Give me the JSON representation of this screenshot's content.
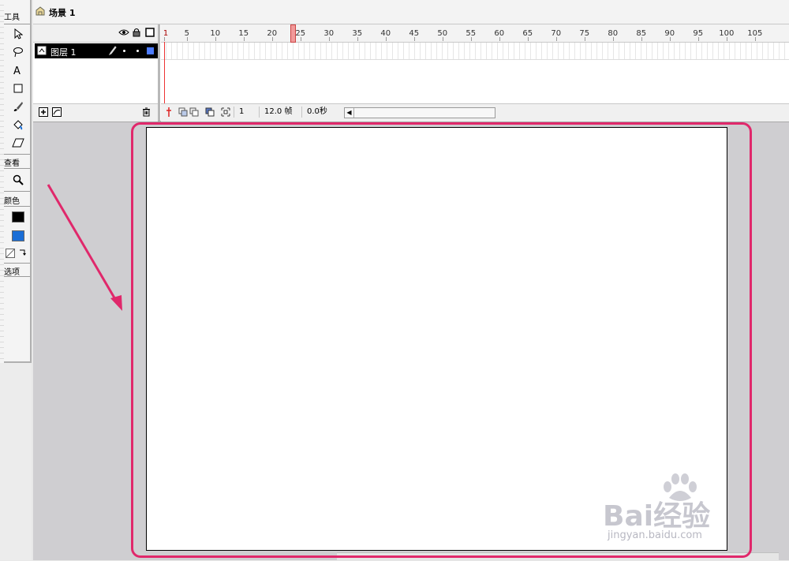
{
  "scene": {
    "title": "场景 1"
  },
  "toolbar": {
    "tools_label": "工具",
    "view_label": "查看",
    "colors_label": "颜色",
    "options_label": "选项",
    "stroke_color": "#000000",
    "fill_color": "#1a6ed6",
    "tools": [
      "arrow-tool-icon",
      "lasso-tool-icon",
      "text-tool-icon",
      "rectangle-tool-icon",
      "brush-tool-icon",
      "paint-bucket-icon",
      "eraser-icon"
    ]
  },
  "timeline": {
    "layer_name": "图层 1",
    "frame_numbers": [
      "1",
      "5",
      "10",
      "15",
      "20",
      "25",
      "30",
      "35",
      "40",
      "45",
      "50",
      "55",
      "60",
      "65",
      "70",
      "75",
      "80",
      "85",
      "90",
      "95",
      "100",
      "105"
    ],
    "current_frame": "1",
    "frame_rate": "12.0 帧",
    "elapsed_time": "0.0秒"
  },
  "accent_color": "#e0286b",
  "watermark": {
    "text": "Bai经验",
    "sub": "jingyan.baidu.com"
  }
}
